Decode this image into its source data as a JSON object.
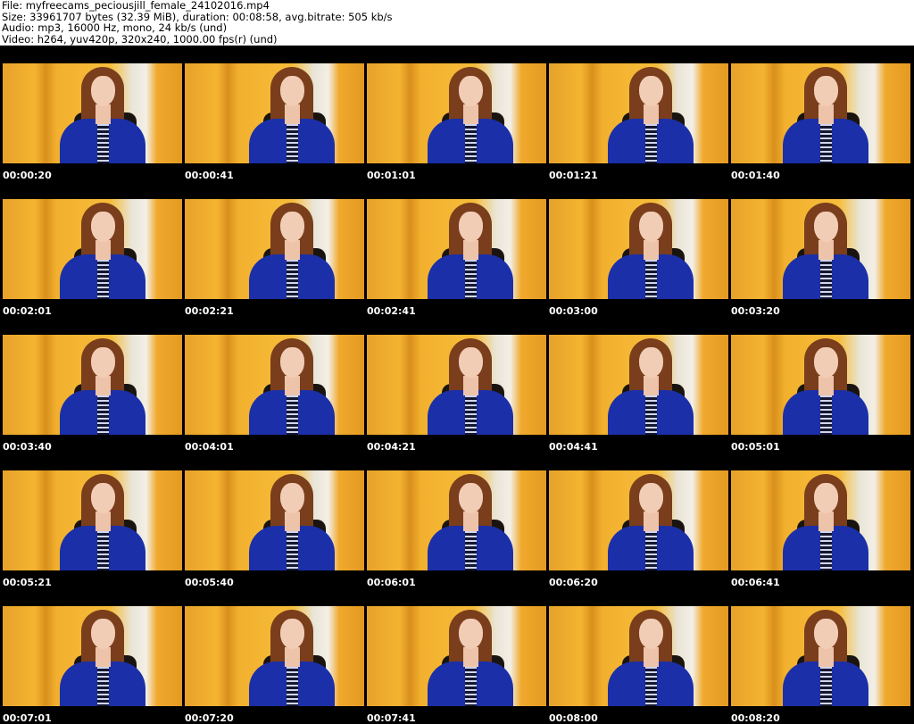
{
  "header": {
    "file": "File: myfreecams_peciousjill_female_24102016.mp4",
    "size": "Size: 33961707 bytes (32.39 MiB), duration: 00:08:58, avg.bitrate: 505 kb/s",
    "audio": "Audio: mp3, 16000 Hz, mono, 24 kb/s (und)",
    "video": "Video: h264, yuv420p, 320x240, 1000.00 fps(r) (und)"
  },
  "thumbnails": [
    "00:00:20",
    "00:00:41",
    "00:01:01",
    "00:01:21",
    "00:01:40",
    "00:02:01",
    "00:02:21",
    "00:02:41",
    "00:03:00",
    "00:03:20",
    "00:03:40",
    "00:04:01",
    "00:04:21",
    "00:04:41",
    "00:05:01",
    "00:05:21",
    "00:05:40",
    "00:06:01",
    "00:06:20",
    "00:06:41",
    "00:07:01",
    "00:07:20",
    "00:07:41",
    "00:08:00",
    "00:08:20"
  ]
}
